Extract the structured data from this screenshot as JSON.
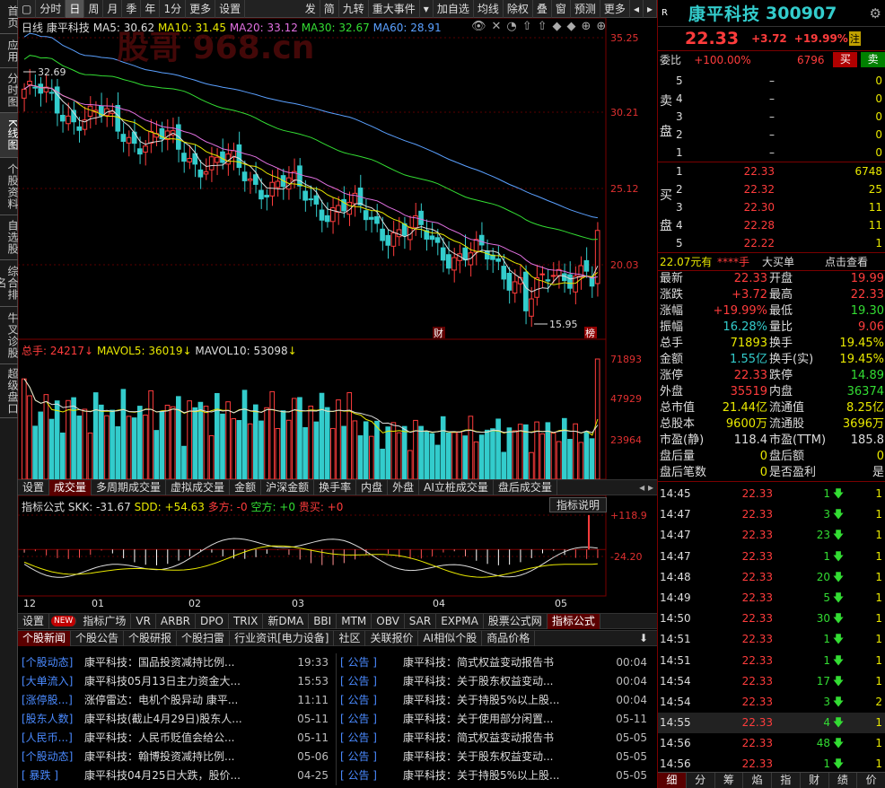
{
  "leftnav": [
    "首页",
    "应用",
    "分时图",
    "K线图",
    "个股资料",
    "自选股",
    "综合排名",
    "牛叉诊股",
    "超级盘口"
  ],
  "toolbar": {
    "left": [
      "分时",
      "日",
      "周",
      "月",
      "季",
      "年",
      "1分",
      "更多",
      "设置"
    ],
    "right": [
      "发",
      "简",
      "九转",
      "重大事件",
      "▾",
      "加自选",
      "均线",
      "除权",
      "叠",
      "窗",
      "预测",
      "更多",
      "◂",
      "▸"
    ]
  },
  "legend": {
    "period": "日线",
    "name": "康平科技",
    "ma5": "MA5: 30.62",
    "ma10": "MA10: 31.45",
    "ma20": "MA20: 33.12",
    "ma30": "MA30: 32.67",
    "ma60": "MA60: 28.91"
  },
  "watermark": "股哥 968.cn",
  "price_axis": [
    "35.25",
    "30.21",
    "25.12",
    "20.03"
  ],
  "annotations": {
    "high": "32.69",
    "low": "15.95",
    "cai": "财",
    "bang": "榜"
  },
  "vol_legend": {
    "total": "总手: 24217",
    "mavol5": "MAVOL5: 36019",
    "mavol10": "MAVOL10: 53098"
  },
  "vol_axis": [
    "71893",
    "47929",
    "23964"
  ],
  "vol_tabs": [
    "设置",
    "成交量",
    "多周期成交量",
    "虚拟成交量",
    "金额",
    "沪深金额",
    "换手率",
    "内盘",
    "外盘",
    "AI立桩成交量",
    "盘后成交量"
  ],
  "ind_legend": {
    "name": "指标公式",
    "skk": "SKK: -31.67",
    "sdd": "SDD: +54.63",
    "duo": "多方: -0",
    "kong": "空方: +0",
    "gui": "贵买: +0",
    "btn": "指标说明"
  },
  "ind_axis": [
    "+118.9",
    "-24.20"
  ],
  "months": [
    "12",
    "01",
    "02",
    "03",
    "04",
    "05"
  ],
  "ind_tabs": [
    "设置",
    "NEW",
    "指标广场",
    "VR",
    "ARBR",
    "DPO",
    "TRIX",
    "新DMA",
    "BBI",
    "MTM",
    "OBV",
    "SAR",
    "EXPMA",
    "股票公式网",
    "指标公式"
  ],
  "news_tabs": [
    "个股新闻",
    "个股公告",
    "个股研报",
    "个股扫雷",
    "行业资讯[电力设备]",
    "社区",
    "关联报价",
    "AI相似个股",
    "商品价格"
  ],
  "news_left": [
    {
      "tag": "[个股动态]",
      "text": "康平科技：国品投资减持比例...",
      "time": "19:33"
    },
    {
      "tag": "[大单流入]",
      "text": "康平科技05月13日主力资金大...",
      "time": "15:53"
    },
    {
      "tag": "[涨停股...]",
      "text": "涨停雷达：电机个股异动 康平...",
      "time": "11:11"
    },
    {
      "tag": "[股东人数]",
      "text": "康平科技(截止4月29日)股东人...",
      "time": "05-11"
    },
    {
      "tag": "[人民币...]",
      "text": "康平科技：人民币贬值会给公...",
      "time": "05-11"
    },
    {
      "tag": "[个股动态]",
      "text": "康平科技：翰博投资减持比例...",
      "time": "05-06"
    },
    {
      "tag": "[ 暴跌 ]",
      "text": "康平科技04月25日大跌，股价...",
      "time": "04-25"
    }
  ],
  "news_right": [
    {
      "tag": "[ 公告 ]",
      "text": "康平科技：简式权益变动报告书",
      "time": "00:04"
    },
    {
      "tag": "[ 公告 ]",
      "text": "康平科技：关于股东权益变动...",
      "time": "00:04"
    },
    {
      "tag": "[ 公告 ]",
      "text": "康平科技：关于持股5%以上股...",
      "time": "00:04"
    },
    {
      "tag": "[ 公告 ]",
      "text": "康平科技：关于使用部分闲置...",
      "time": "05-11"
    },
    {
      "tag": "[ 公告 ]",
      "text": "康平科技：简式权益变动报告书",
      "time": "05-05"
    },
    {
      "tag": "[ 公告 ]",
      "text": "康平科技：关于股东权益变动...",
      "time": "05-05"
    },
    {
      "tag": "[ 公告 ]",
      "text": "康平科技：关于持股5%以上股...",
      "time": "05-05"
    }
  ],
  "stock": {
    "r": "R",
    "name": "康平科技",
    "code": "300907",
    "price": "22.33",
    "chg": "+3.72",
    "pct": "+19.99%",
    "zhu": "注"
  },
  "weibi": {
    "label": "委比",
    "pct": "+100.00%",
    "diff": "6796",
    "buy": "买",
    "sell": "卖"
  },
  "sell_orders": [
    {
      "n": "5",
      "p": "–",
      "v": "0"
    },
    {
      "n": "4",
      "p": "–",
      "v": "0"
    },
    {
      "n": "3",
      "p": "–",
      "v": "0"
    },
    {
      "n": "2",
      "p": "–",
      "v": "0"
    },
    {
      "n": "1",
      "p": "–",
      "v": "0"
    }
  ],
  "sell_label": [
    "卖",
    "盘"
  ],
  "buy_label": [
    "买",
    "盘"
  ],
  "buy_orders": [
    {
      "n": "1",
      "p": "22.33",
      "v": "6748"
    },
    {
      "n": "2",
      "p": "22.32",
      "v": "25"
    },
    {
      "n": "3",
      "p": "22.30",
      "v": "11"
    },
    {
      "n": "4",
      "p": "22.28",
      "v": "11"
    },
    {
      "n": "5",
      "p": "22.22",
      "v": "1"
    }
  ],
  "bigorder": {
    "amt": "22.07元有",
    "stars": "****手",
    "label": "大买单",
    "link": "点击查看"
  },
  "stats": [
    [
      "最新",
      "22.33",
      "开盘",
      "19.99"
    ],
    [
      "涨跌",
      "+3.72",
      "最高",
      "22.33"
    ],
    [
      "涨幅",
      "+19.99%",
      "最低",
      "19.30"
    ],
    [
      "振幅",
      "16.28%",
      "量比",
      "9.06"
    ],
    [
      "总手",
      "71893",
      "换手",
      "19.45%"
    ],
    [
      "金额",
      "1.55亿",
      "换手(实)",
      "19.45%"
    ],
    [
      "涨停",
      "22.33",
      "跌停",
      "14.89"
    ],
    [
      "外盘",
      "35519",
      "内盘",
      "36374"
    ],
    [
      "总市值",
      "21.44亿",
      "流通值",
      "8.25亿"
    ],
    [
      "总股本",
      "9600万",
      "流通股",
      "3696万"
    ],
    [
      "市盈(静)",
      "118.4",
      "市盈(TTM)",
      "185.8"
    ],
    [
      "盘后量",
      "0",
      "盘后额",
      "0"
    ],
    [
      "盘后笔数",
      "0",
      "是否盈利",
      "是"
    ]
  ],
  "ticks": [
    {
      "t": "14:45",
      "p": "22.33",
      "v": "1",
      "n": "1"
    },
    {
      "t": "14:47",
      "p": "22.33",
      "v": "3",
      "n": "1"
    },
    {
      "t": "14:47",
      "p": "22.33",
      "v": "23",
      "n": "1"
    },
    {
      "t": "14:47",
      "p": "22.33",
      "v": "1",
      "n": "1"
    },
    {
      "t": "14:48",
      "p": "22.33",
      "v": "20",
      "n": "1"
    },
    {
      "t": "14:49",
      "p": "22.33",
      "v": "5",
      "n": "1"
    },
    {
      "t": "14:50",
      "p": "22.33",
      "v": "30",
      "n": "1"
    },
    {
      "t": "14:51",
      "p": "22.33",
      "v": "1",
      "n": "1"
    },
    {
      "t": "14:51",
      "p": "22.33",
      "v": "1",
      "n": "1"
    },
    {
      "t": "14:54",
      "p": "22.33",
      "v": "17",
      "n": "1"
    },
    {
      "t": "14:54",
      "p": "22.33",
      "v": "3",
      "n": "2"
    },
    {
      "t": "14:55",
      "p": "22.33",
      "v": "4",
      "n": "1"
    },
    {
      "t": "14:56",
      "p": "22.33",
      "v": "48",
      "n": "1"
    },
    {
      "t": "14:56",
      "p": "22.33",
      "v": "1",
      "n": "1"
    }
  ],
  "bottom_tabs": [
    "细",
    "分",
    "筹",
    "焰",
    "指",
    "财",
    "绩",
    "价"
  ]
}
